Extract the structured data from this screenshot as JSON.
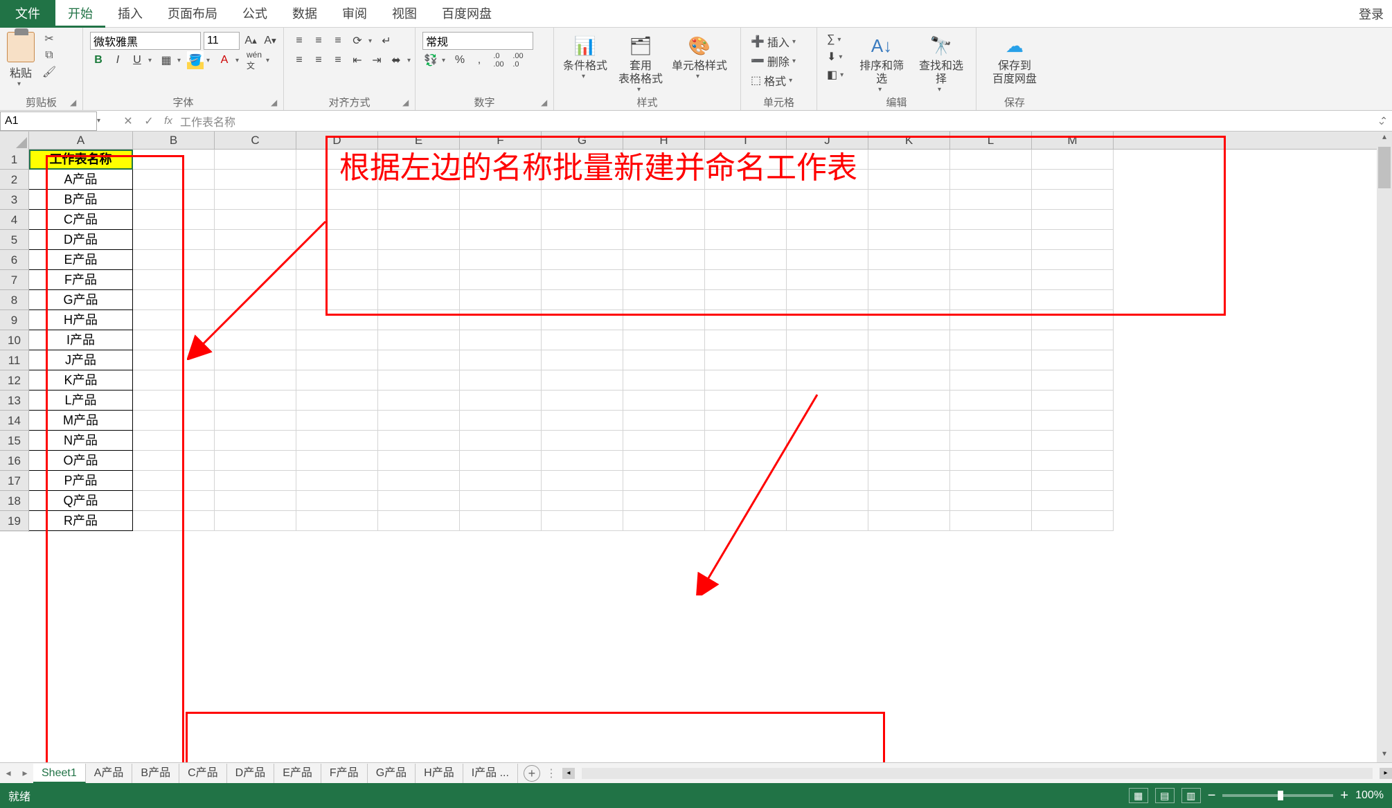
{
  "menu": {
    "file": "文件",
    "tabs": [
      "开始",
      "插入",
      "页面布局",
      "公式",
      "数据",
      "审阅",
      "视图",
      "百度网盘"
    ],
    "active_index": 0,
    "login": "登录"
  },
  "ribbon": {
    "clipboard": {
      "paste": "粘贴",
      "group": "剪贴板"
    },
    "font": {
      "name": "微软雅黑",
      "size": "11",
      "group": "字体"
    },
    "align": {
      "group": "对齐方式"
    },
    "number": {
      "format": "常规",
      "group": "数字"
    },
    "styles": {
      "cond": "条件格式",
      "table": "套用\n表格格式",
      "cell": "单元格样式",
      "group": "样式"
    },
    "cells": {
      "insert": "插入",
      "delete": "删除",
      "format": "格式",
      "group": "单元格"
    },
    "editing": {
      "sortfilter": "排序和筛选",
      "findselect": "查找和选择",
      "group": "编辑"
    },
    "save": {
      "btn": "保存到\n百度网盘",
      "group": "保存"
    }
  },
  "name_box": "A1",
  "formula_value": "工作表名称",
  "columns": [
    "A",
    "B",
    "C",
    "D",
    "E",
    "F",
    "G",
    "H",
    "I",
    "J",
    "K",
    "L",
    "M"
  ],
  "rows": [
    1,
    2,
    3,
    4,
    5,
    6,
    7,
    8,
    9,
    10,
    11,
    12,
    13,
    14,
    15,
    16,
    17,
    18,
    19
  ],
  "col_a": [
    "工作表名称",
    "A产品",
    "B产品",
    "C产品",
    "D产品",
    "E产品",
    "F产品",
    "G产品",
    "H产品",
    "I产品",
    "J产品",
    "K产品",
    "L产品",
    "M产品",
    "N产品",
    "O产品",
    "P产品",
    "Q产品",
    "R产品"
  ],
  "sheet_tabs": [
    "Sheet1",
    "A产品",
    "B产品",
    "C产品",
    "D产品",
    "E产品",
    "F产品",
    "G产品",
    "H产品",
    "I产品 ..."
  ],
  "active_sheet_index": 0,
  "annotation_text": "根据左边的名称批量新建并命名工作表",
  "status": {
    "ready": "就绪",
    "zoom": "100%"
  }
}
